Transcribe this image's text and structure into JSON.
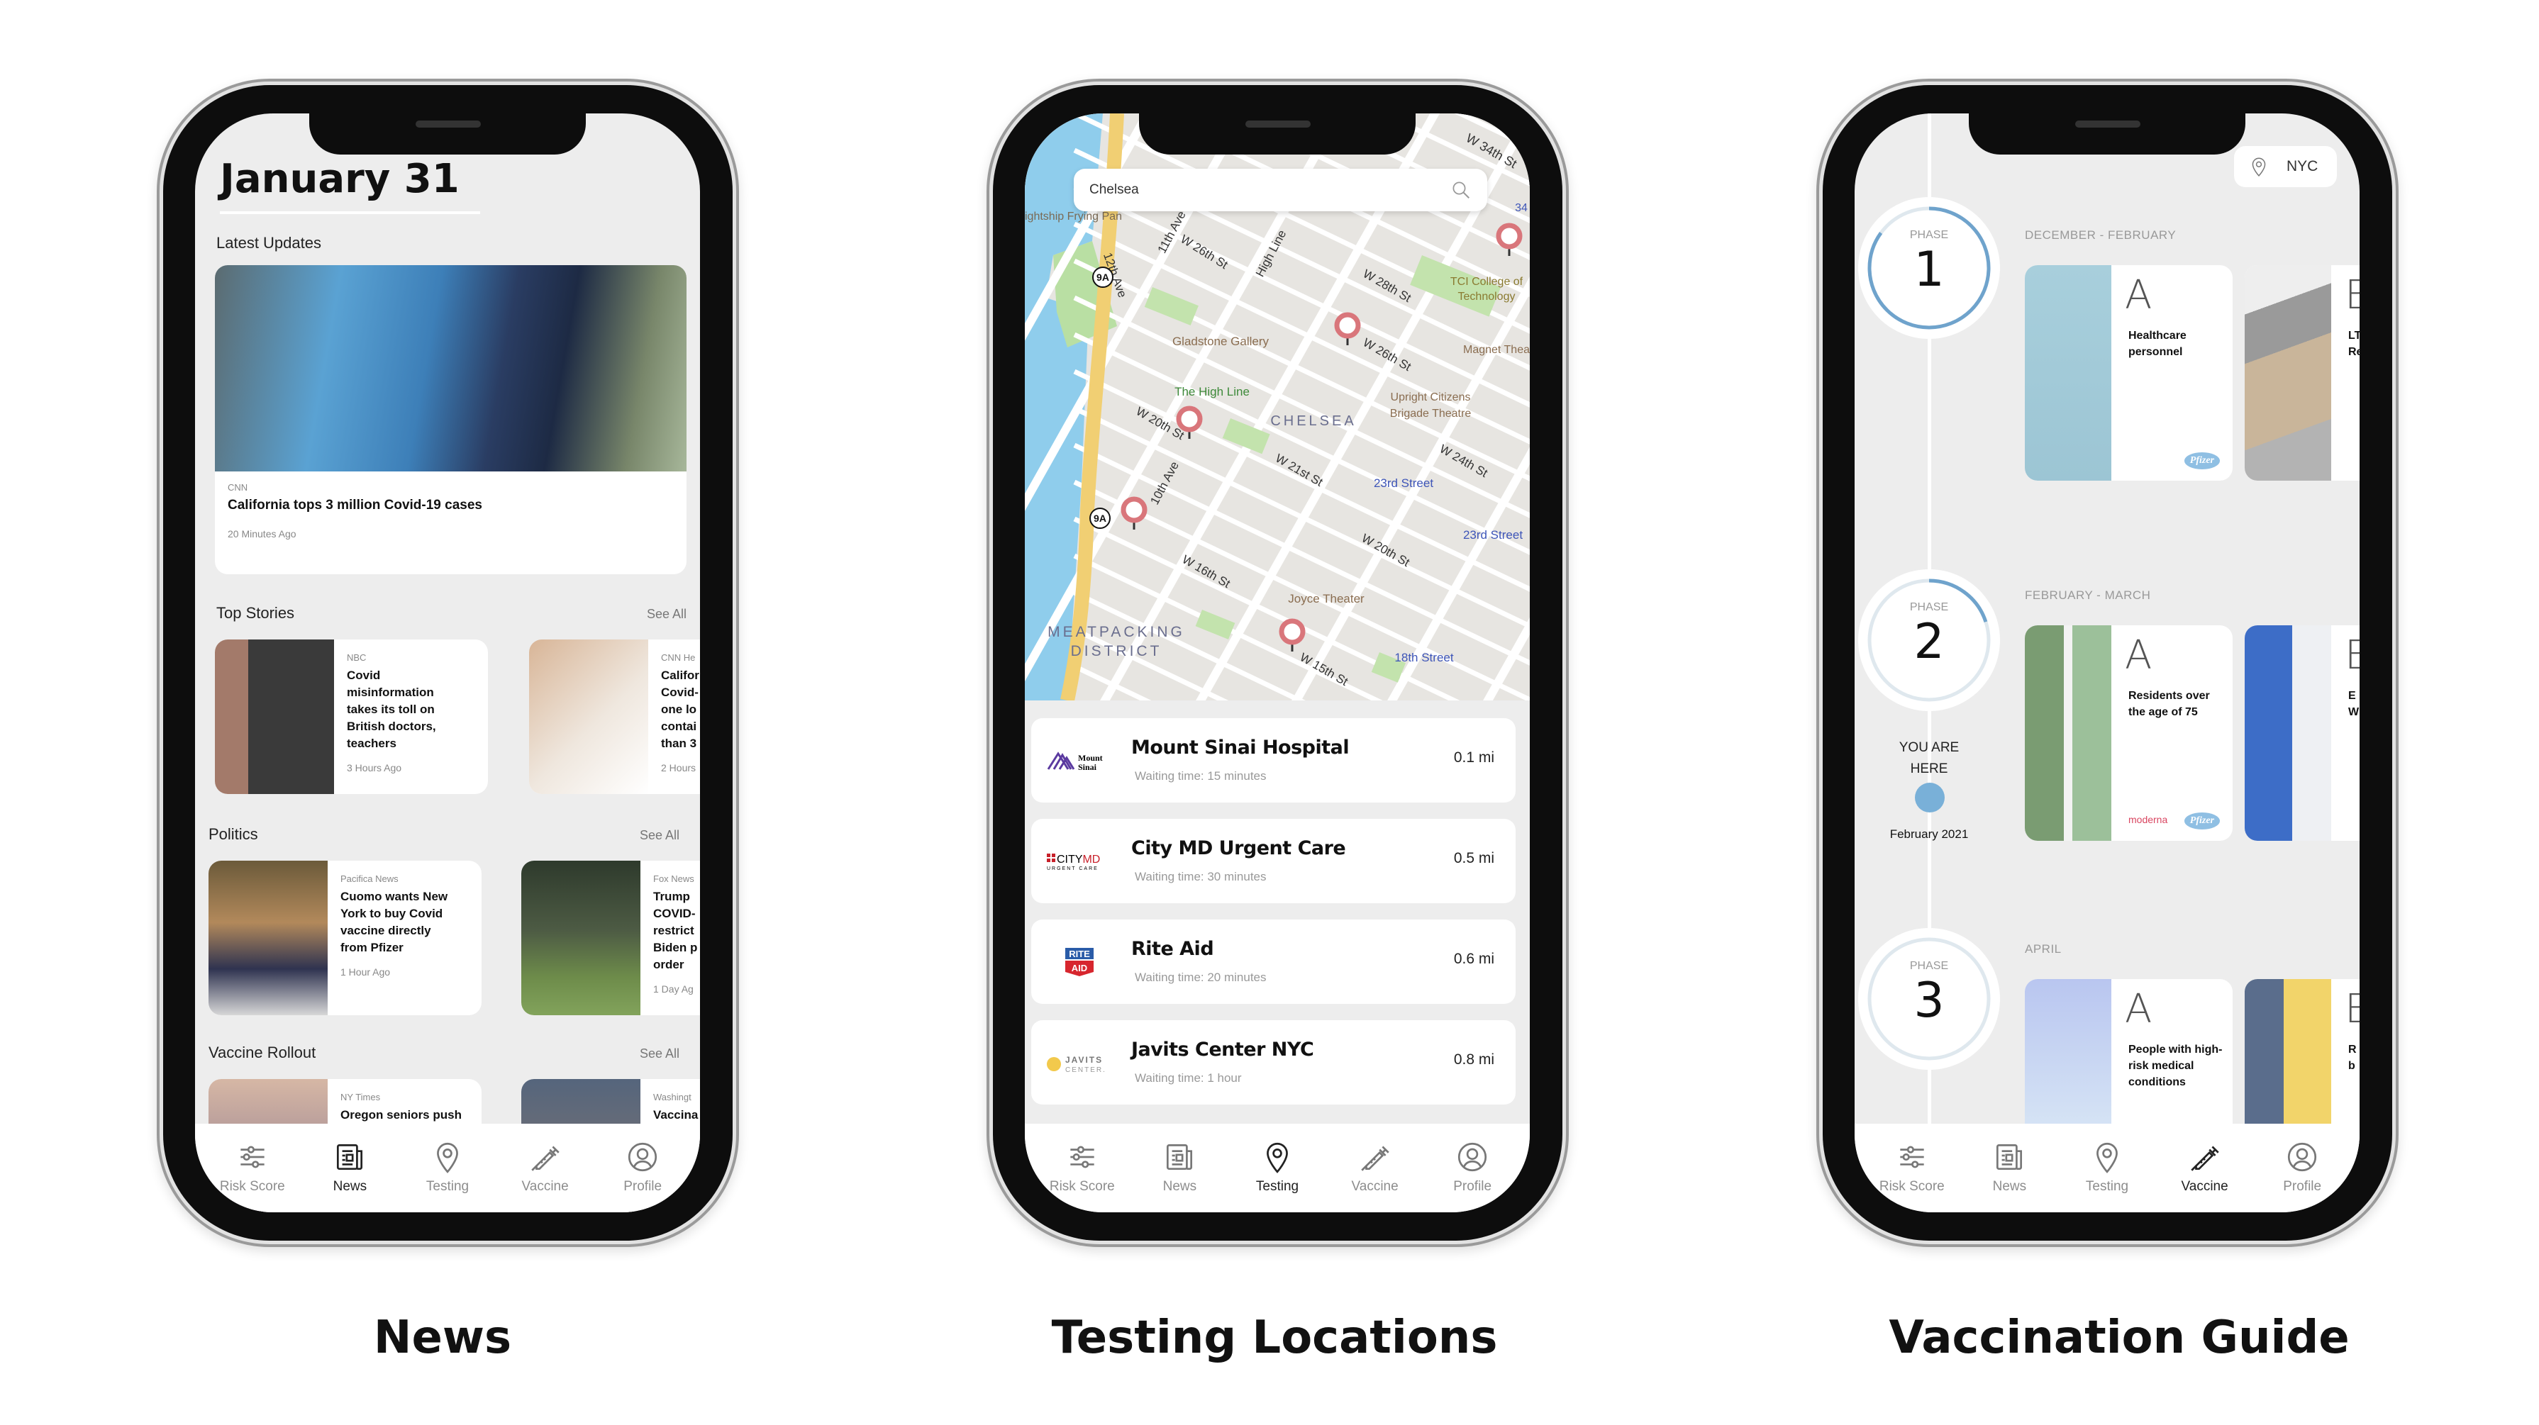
{
  "captions": [
    "News",
    "Testing Locations",
    "Vaccination Guide"
  ],
  "tab_bar": {
    "items": [
      {
        "label": "Risk Score",
        "icon": "sliders-icon"
      },
      {
        "label": "News",
        "icon": "newspaper-icon"
      },
      {
        "label": "Testing",
        "icon": "map-pin-icon"
      },
      {
        "label": "Vaccine",
        "icon": "syringe-icon"
      },
      {
        "label": "Profile",
        "icon": "user-circle-icon"
      }
    ]
  },
  "news": {
    "active_tab": "News",
    "date": "January 31",
    "latest": {
      "heading": "Latest Updates",
      "source": "CNN",
      "title": "California tops 3 million Covid-19 cases",
      "time": "20 Minutes Ago"
    },
    "sections": [
      {
        "heading": "Top Stories",
        "see_all": "See All",
        "cards": [
          {
            "source": "NBC",
            "title": [
              "Covid",
              "misinformation",
              "takes its toll on",
              "British doctors,",
              "teachers"
            ],
            "time": "3 Hours Ago"
          },
          {
            "source": "CNN He",
            "title": [
              "Califor",
              "Covid-",
              "one lo",
              "contai",
              "than 3"
            ],
            "time": "2 Hours"
          }
        ]
      },
      {
        "heading": "Politics",
        "see_all": "See All",
        "cards": [
          {
            "source": "Pacifica News",
            "title": [
              "Cuomo wants New",
              "York to buy Covid",
              "vaccine directly",
              "from Pfizer"
            ],
            "time": "1 Hour Ago"
          },
          {
            "source": "Fox News",
            "title": [
              "Trump",
              "COVID-",
              "restrict",
              "Biden p",
              "order"
            ],
            "time": "1 Day Ag"
          }
        ]
      },
      {
        "heading": "Vaccine Rollout",
        "see_all": "See All",
        "cards": [
          {
            "source": "NY Times",
            "title": [
              "Oregon seniors push"
            ],
            "time": ""
          },
          {
            "source": "Washingt",
            "title": [
              "Vaccina"
            ],
            "time": ""
          }
        ]
      }
    ]
  },
  "testing": {
    "active_tab": "Testing",
    "search_value": "Chelsea",
    "map_labels": [
      "ightship Frying Pan",
      "W 34th St",
      "W 26th St",
      "High Line",
      "11th Ave",
      "12th Ave",
      "Gladstone Gallery",
      "The High Line",
      "W 28th St",
      "TCI College of",
      "Technology",
      "W 26th St",
      "Magnet Thea",
      "Upright Citizens",
      "Brigade Theatre",
      "CHELSEA",
      "W 20th St",
      "10th Ave",
      "W 21st St",
      "23rd Street",
      "W 24th St",
      "23rd Street",
      "W 20th St",
      "W 16th St",
      "Joyce Theater",
      "MEATPACKING",
      "DISTRICT",
      "18th Street",
      "W 15th St",
      "9A",
      "9A",
      "34"
    ],
    "locations": [
      {
        "name": "Mount Sinai Hospital",
        "wait": "Waiting time: 15 minutes",
        "distance": "0.1 mi",
        "logo": "Mount Sinai"
      },
      {
        "name": "City MD Urgent Care",
        "wait": "Waiting time: 30 minutes",
        "distance": "0.5 mi",
        "logo": "CITYMD URGENT CARE"
      },
      {
        "name": "Rite Aid",
        "wait": "Waiting time: 20 minutes",
        "distance": "0.6 mi",
        "logo": "RITE AID"
      },
      {
        "name": "Javits Center NYC",
        "wait": "Waiting time: 1 hour",
        "distance": "0.8 mi",
        "logo": "JAVITS CENTER"
      }
    ],
    "colors": {
      "pin": "#d9767b",
      "water": "#8fcdec",
      "highway": "#f1cf73",
      "transit": "#3e55b8"
    }
  },
  "vaccine": {
    "active_tab": "Vaccine",
    "location": "NYC",
    "you_are_here": [
      "YOU ARE",
      "HERE"
    ],
    "current_date": "February 2021",
    "accent": "#6fa3cc",
    "phases": [
      {
        "label": "PHASE",
        "number": "1",
        "period": "DECEMBER - FEBRUARY",
        "progress": 0.85,
        "groups": [
          {
            "letter": "A",
            "text": "Healthcare personnel",
            "brands": [
              "Pfizer"
            ]
          },
          {
            "letter": "B",
            "text": "LT\nRe",
            "brands": []
          }
        ]
      },
      {
        "label": "PHASE",
        "number": "2",
        "period": "FEBRUARY - MARCH",
        "progress": 0.2,
        "groups": [
          {
            "letter": "A",
            "text": "Residents over the age of 75",
            "brands": [
              "moderna",
              "Pfizer"
            ]
          },
          {
            "letter": "E",
            "text": "E\nW",
            "brands": []
          }
        ]
      },
      {
        "label": "PHASE",
        "number": "3",
        "period": "APRIL",
        "progress": 0,
        "groups": [
          {
            "letter": "A",
            "text": "People with high-risk medical conditions",
            "brands": []
          },
          {
            "letter": "B",
            "text": "R\nb",
            "brands": []
          }
        ]
      }
    ]
  }
}
